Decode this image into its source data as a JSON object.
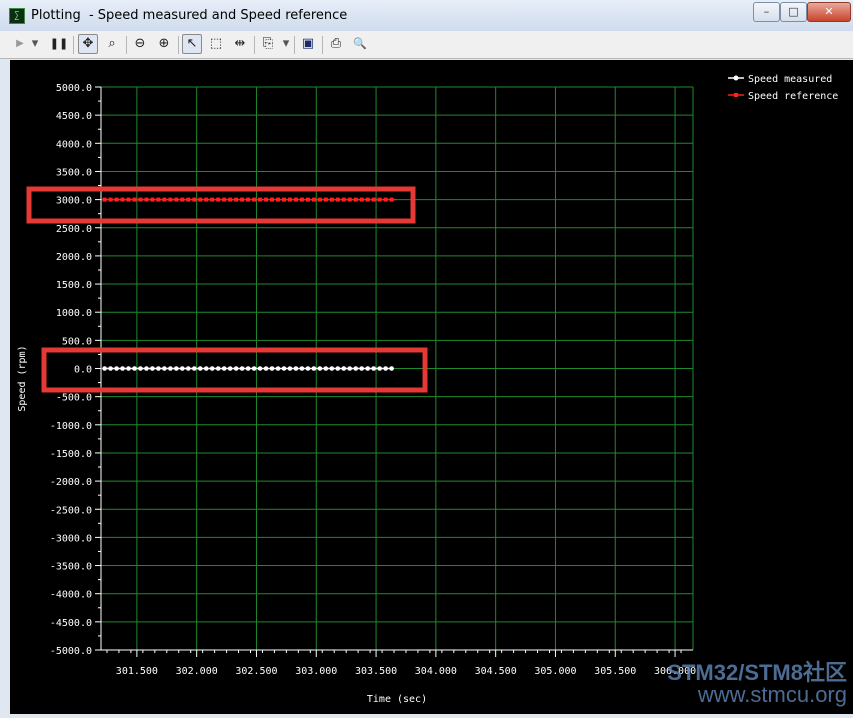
{
  "window": {
    "title": "Plotting  - Speed measured and Speed reference",
    "app_icon_label": "∑",
    "buttons": {
      "minimize": "–",
      "maximize": "□",
      "close": "✕"
    }
  },
  "toolbar": {
    "icons": [
      "play-icon",
      "dropdown-icon",
      "pause-icon",
      "pan-icon",
      "zoom-area-icon",
      "zoom-out-icon",
      "zoom-in-icon",
      "select-icon",
      "box-select-icon",
      "cursor-measure-icon",
      "copy-icon",
      "dropdown-icon",
      "save-icon",
      "print-icon",
      "print-preview-icon"
    ],
    "glyphs": {
      "play": "▶",
      "dropdown": "▾",
      "pause": "❚❚",
      "pan": "✥",
      "zoom_area": "⌕",
      "zoom_out": "⊖",
      "zoom_in": "⊕",
      "select": "↖",
      "box_select": "⬚",
      "cursor_measure": "⇹",
      "copy": "⎘",
      "save": "▣",
      "print": "⎙",
      "print_preview": "🔍"
    }
  },
  "chart_data": {
    "type": "line",
    "xlabel": "Time (sec)",
    "ylabel": "Speed (rpm)",
    "xlim": [
      301.2,
      306.15
    ],
    "ylim": [
      -5000,
      5000
    ],
    "x_ticks": [
      301.5,
      302.0,
      302.5,
      303.0,
      303.5,
      304.0,
      304.5,
      305.0,
      305.5,
      306.0
    ],
    "x_tick_labels": [
      "301.500",
      "302.000",
      "302.500",
      "303.000",
      "303.500",
      "304.000",
      "304.500",
      "305.000",
      "305.500",
      "306.000"
    ],
    "y_ticks": [
      5000,
      4500,
      4000,
      3500,
      3000,
      2500,
      2000,
      1500,
      1000,
      500,
      0,
      -500,
      -1000,
      -1500,
      -2000,
      -2500,
      -3000,
      -3500,
      -4000,
      -4500,
      -5000
    ],
    "y_tick_labels": [
      "5000.0",
      "4500.0",
      "4000.0",
      "3500.0",
      "3000.0",
      "2500.0",
      "2000.0",
      "1500.0",
      "1000.0",
      "500.0",
      "0.0",
      "-500.0",
      "-1000.0",
      "-1500.0",
      "-2000.0",
      "-2500.0",
      "-3000.0",
      "-3500.0",
      "-4000.0",
      "-4500.0",
      "-5000.0"
    ],
    "grid": true,
    "legend_position": "top-right",
    "series": [
      {
        "name": "Speed measured",
        "color": "#ffffff",
        "marker": "circle",
        "x_start": 301.23,
        "x_end": 303.63,
        "y": 0
      },
      {
        "name": "Speed reference",
        "color": "#ff2020",
        "marker": "square",
        "x_start": 301.23,
        "x_end": 303.67,
        "y": 3000
      }
    ],
    "highlight_color": "#e53935"
  },
  "watermark": {
    "line1": "STM32/STM8社区",
    "line2": "www.stmcu.org"
  }
}
